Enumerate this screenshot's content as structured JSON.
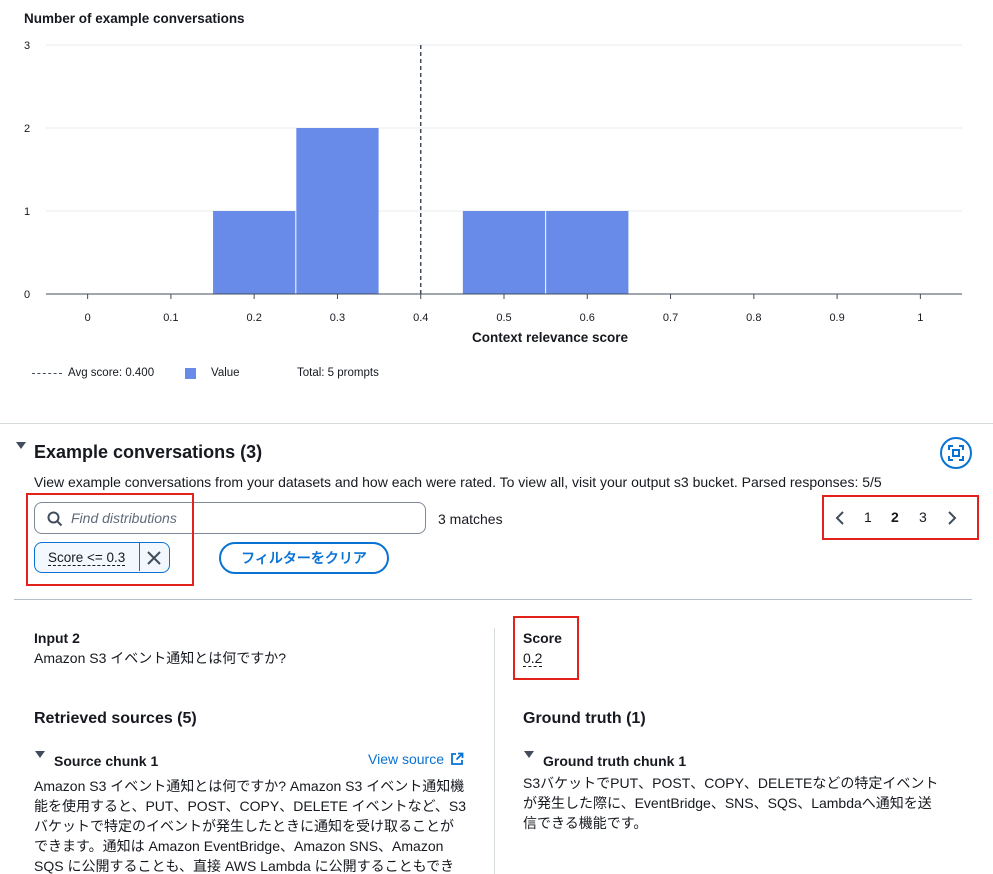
{
  "chart_title": "Number of example conversations",
  "chart_data": {
    "type": "bar",
    "title": "Number of example conversations",
    "xlabel": "Context relevance score",
    "ylabel": "",
    "x_ticks": [
      "0",
      "0.1",
      "0.2",
      "0.3",
      "0.4",
      "0.5",
      "0.6",
      "0.7",
      "0.8",
      "0.9",
      "1"
    ],
    "y_ticks": [
      "0",
      "1",
      "2",
      "3"
    ],
    "xlim": [
      -0.05,
      1.05
    ],
    "ylim": [
      0,
      3
    ],
    "bins": [
      {
        "x0": 0.15,
        "x1": 0.25,
        "value": 1
      },
      {
        "x0": 0.25,
        "x1": 0.35,
        "value": 2
      },
      {
        "x0": 0.45,
        "x1": 0.55,
        "value": 1
      },
      {
        "x0": 0.55,
        "x1": 0.65,
        "value": 1
      }
    ],
    "avg_line": 0.4,
    "grid": true,
    "bar_color": "#688ae8",
    "legend_placement": "bottom-left"
  },
  "legend": {
    "avg_label": "Avg score: 0.400",
    "value_label": "Value",
    "total_label": "Total: 5 prompts"
  },
  "section": {
    "title": "Example conversations (3)",
    "description": "View example conversations from your datasets and how each were rated. To view all, visit your output s3 bucket. Parsed responses: 5/5",
    "expand_icon": "fullscreen-icon"
  },
  "search": {
    "placeholder": "Find distributions",
    "value": "",
    "matches": "3 matches"
  },
  "filter": {
    "token_label": "Score <= 0.3",
    "clear_label": "フィルターをクリア"
  },
  "pagination": {
    "pages": [
      "1",
      "2",
      "3"
    ],
    "current": "2"
  },
  "conversation": {
    "input_label": "Input 2",
    "input_text": "Amazon S3 イベント通知とは何ですか?",
    "score_label": "Score",
    "score_value": "0.2",
    "retrieved_title": "Retrieved sources (5)",
    "chunk_title": "Source chunk 1",
    "view_source": "View source",
    "chunk_lines": [
      "Amazon S3 イベント通知とは何ですか? Amazon S3 イベント通知機",
      "能を使用すると、PUT、POST、COPY、DELETE イベントなど、S3",
      "バケットで特定のイベントが発生したときに通知を受け取ることが",
      "できます。通知は Amazon EventBridge、Amazon SNS、Amazon",
      "SQS に公開することも、直接 AWS Lambda に公開することもでき"
    ],
    "ground_truth_title": "Ground truth (1)",
    "gt_chunk_title": "Ground truth chunk 1",
    "gt_lines": [
      "S3バケットでPUT、POST、COPY、DELETEなどの特定イベント",
      "が発生した際に、EventBridge、SNS、SQS、Lambdaへ通知を送",
      "信できる機能です。"
    ]
  },
  "colors": {
    "accent": "#0972d3",
    "highlight_box": "#e3221b",
    "bar": "#688ae8"
  }
}
